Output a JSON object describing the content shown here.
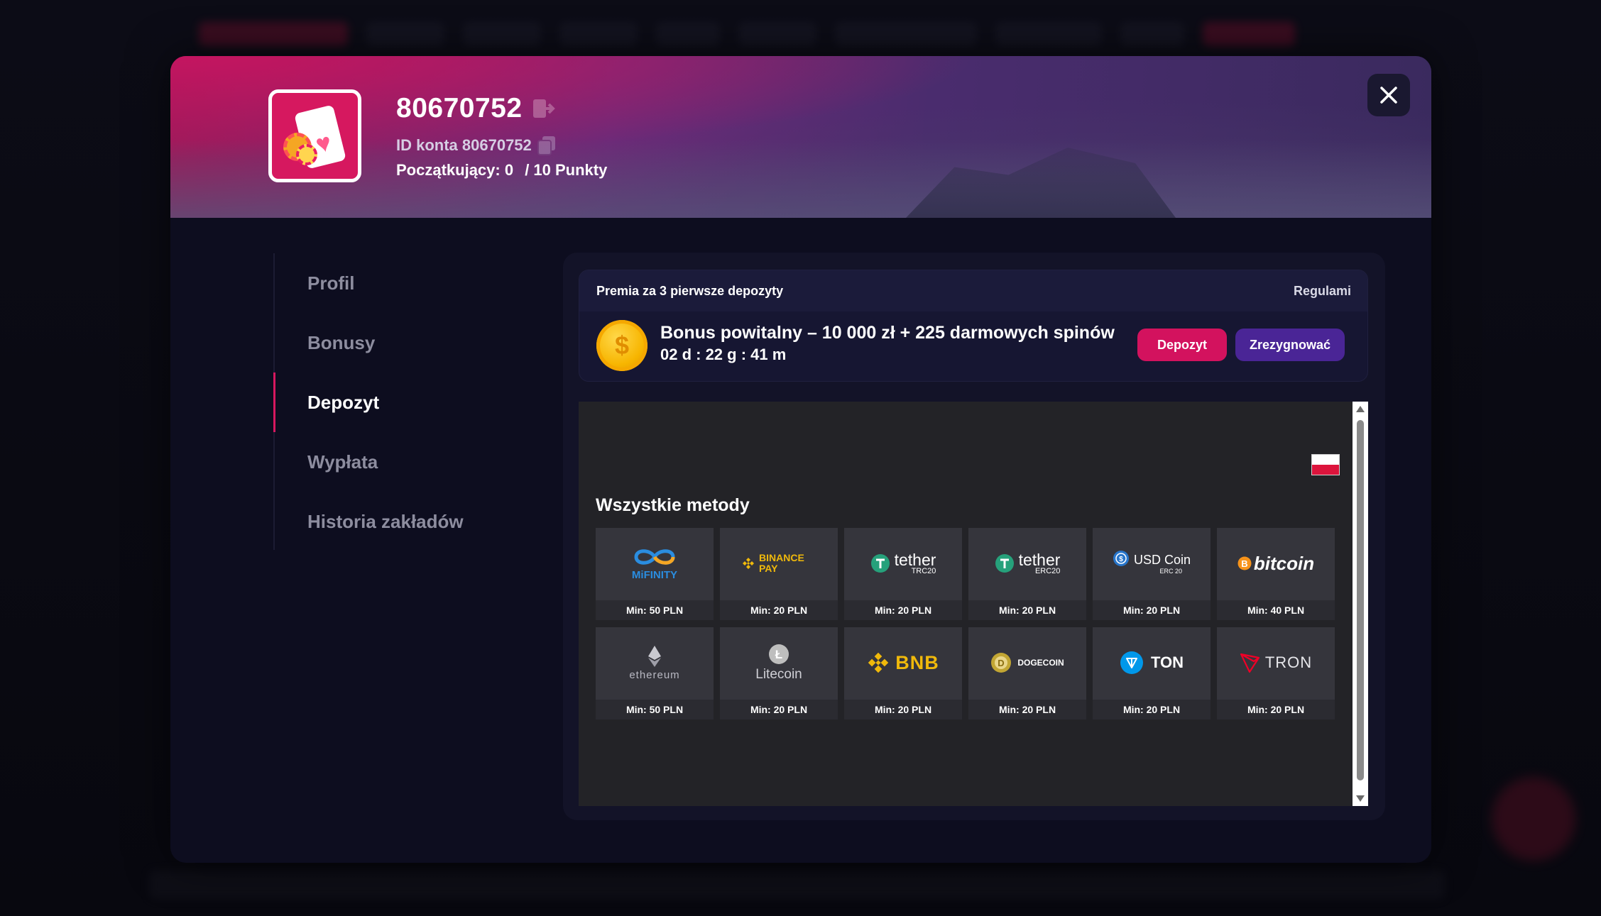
{
  "profile": {
    "username": "80670752",
    "account_id_label": "ID konta 80670752",
    "level_label": "Początkujący: 0",
    "points_label": "/ 10 Punkty"
  },
  "nav": {
    "items": [
      {
        "label": "Profil"
      },
      {
        "label": "Bonusy"
      },
      {
        "label": "Depozyt"
      },
      {
        "label": "Wypłata"
      },
      {
        "label": "Historia zakładów"
      }
    ],
    "active": "Depozyt"
  },
  "promo": {
    "header": "Premia za 3 pierwsze depozyty",
    "rules_link": "Regulamin",
    "title": "Bonus powitalny – 10 000 zł + 225 darmowych spinów",
    "timer": "02 d : 22 g : 41 m",
    "deposit_button": "Depozyt",
    "resign_button": "Zrezygnować"
  },
  "methods": {
    "title": "Wszystkie metody",
    "items": [
      {
        "name": "MiFINITY",
        "icon": "mifinity-logo",
        "min": "Min: 50 PLN"
      },
      {
        "name": "BINANCE PAY",
        "icon": "binance-pay-logo",
        "min": "Min: 20 PLN"
      },
      {
        "name": "tether",
        "sub": "TRC20",
        "icon": "tether-logo",
        "min": "Min: 20 PLN"
      },
      {
        "name": "tether",
        "sub": "ERC20",
        "icon": "tether-logo",
        "min": "Min: 20 PLN"
      },
      {
        "name": "USD Coin",
        "sub": "ERC 20",
        "icon": "usdc-logo",
        "min": "Min: 20 PLN"
      },
      {
        "name": "bitcoin",
        "icon": "bitcoin-logo",
        "min": "Min: 40 PLN"
      },
      {
        "name": "ethereum",
        "icon": "ethereum-logo",
        "min": "Min: 50 PLN"
      },
      {
        "name": "Litecoin",
        "icon": "litecoin-logo",
        "min": "Min: 20 PLN"
      },
      {
        "name": "BNB",
        "icon": "bnb-logo",
        "min": "Min: 20 PLN"
      },
      {
        "name": "DOGECOIN",
        "icon": "dogecoin-logo",
        "min": "Min: 20 PLN"
      },
      {
        "name": "TON",
        "icon": "ton-logo",
        "min": "Min: 20 PLN"
      },
      {
        "name": "TRON",
        "icon": "tron-logo",
        "min": "Min: 20 PLN"
      }
    ]
  },
  "colors": {
    "accent_pink": "#d3125e",
    "accent_purple": "#4a2596",
    "modal_bg": "#0d0d1f",
    "tether_green": "#26a17b",
    "binance_yellow": "#f0b90b",
    "bitcoin_orange": "#f7931a",
    "usdc_blue": "#2775ca",
    "ton_blue": "#0098ea",
    "tron_red": "#ef0027"
  }
}
